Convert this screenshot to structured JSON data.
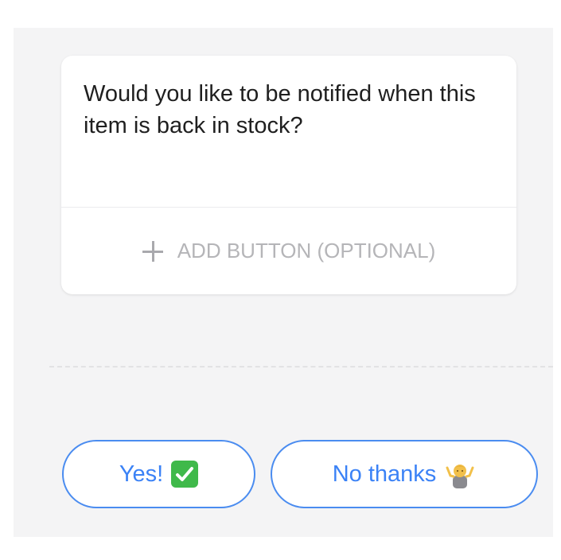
{
  "card": {
    "message": "Would you like to be notified when this item is back in stock?",
    "add_button_label": "ADD BUTTON (OPTIONAL)"
  },
  "quick_replies": [
    {
      "label": "Yes!",
      "icon": "check-mark-emoji"
    },
    {
      "label": "No thanks",
      "icon": "person-shrugging-emoji"
    }
  ],
  "colors": {
    "accent": "#3b82f6",
    "background": "#f4f4f5",
    "card": "#ffffff",
    "muted_text": "#b5b5b8",
    "check_green": "#3fb94a"
  }
}
